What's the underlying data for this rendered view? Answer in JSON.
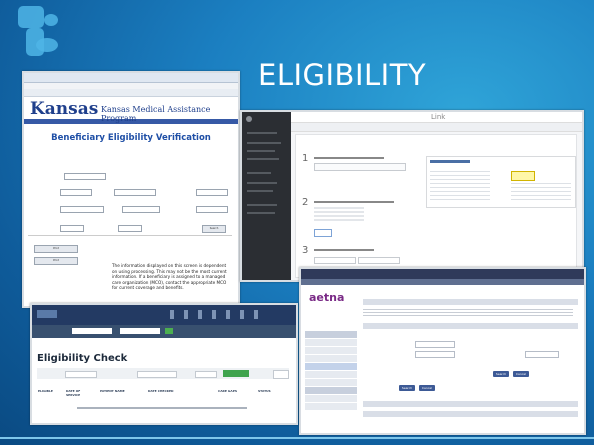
{
  "slide": {
    "title": "ELIGIBILITY"
  },
  "kansas": {
    "logo": "Kansas",
    "program": "Kansas Medical Assistance Program",
    "page_title": "Beneficiary Eligibility Verification",
    "btn_search": "Search",
    "btn_print": "Print",
    "note": "The information displayed on this screen is dependent on using processing. This may not be the most current information. If a beneficiary is assigned to a managed care organization (MCO), contact the appropriate MCO for current coverage and benefits."
  },
  "link": {
    "brand": "Link"
  },
  "aetna": {
    "logo": "aetna",
    "search_button": "Search",
    "cancel_button": "Cancel"
  },
  "elig": {
    "title": "Eligibility Check",
    "columns": [
      "ELIGIBLE",
      "DATE OF SERVICE",
      "PATIENT NAME",
      "DATE CHECKED",
      "CARE GAPS",
      "STATUS"
    ]
  }
}
